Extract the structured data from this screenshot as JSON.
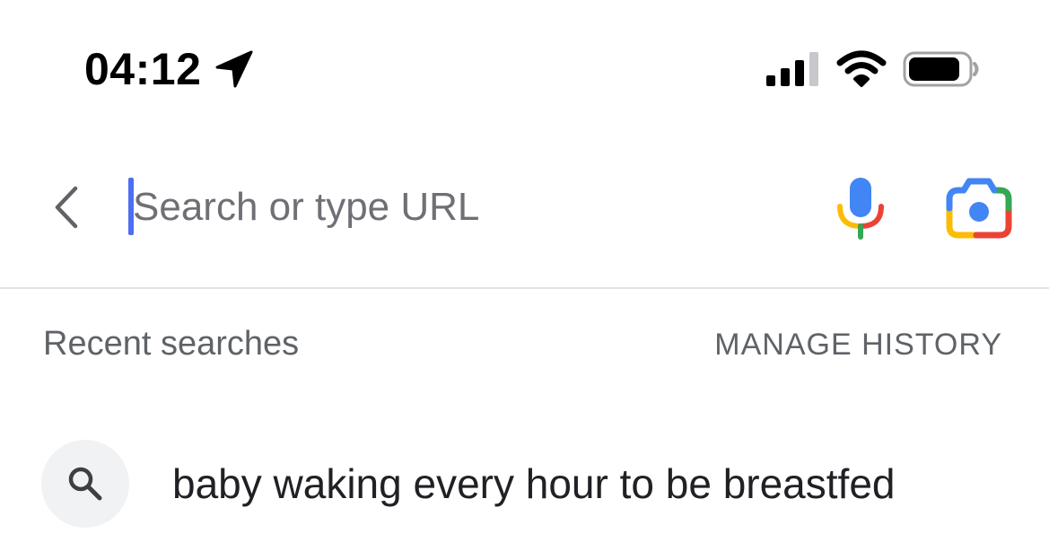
{
  "status_bar": {
    "time": "04:12",
    "icons": [
      "location-arrow-icon",
      "signal-icon",
      "wifi-icon",
      "battery-icon"
    ]
  },
  "search_bar": {
    "placeholder": "Search or type URL",
    "back_icon": "chevron-left-icon",
    "mic_icon": "microphone-icon",
    "lens_icon": "camera-lens-icon",
    "caret_color": "#4e6ef2"
  },
  "recent": {
    "title": "Recent searches",
    "manage_label": "MANAGE HISTORY",
    "items": [
      {
        "text": "baby waking every hour to be breastfed",
        "icon": "search-icon"
      }
    ]
  },
  "colors": {
    "google_blue": "#4285f4",
    "google_red": "#ea4335",
    "google_yellow": "#fbbc05",
    "google_green": "#34a853",
    "secondary_text": "#5f6368"
  }
}
